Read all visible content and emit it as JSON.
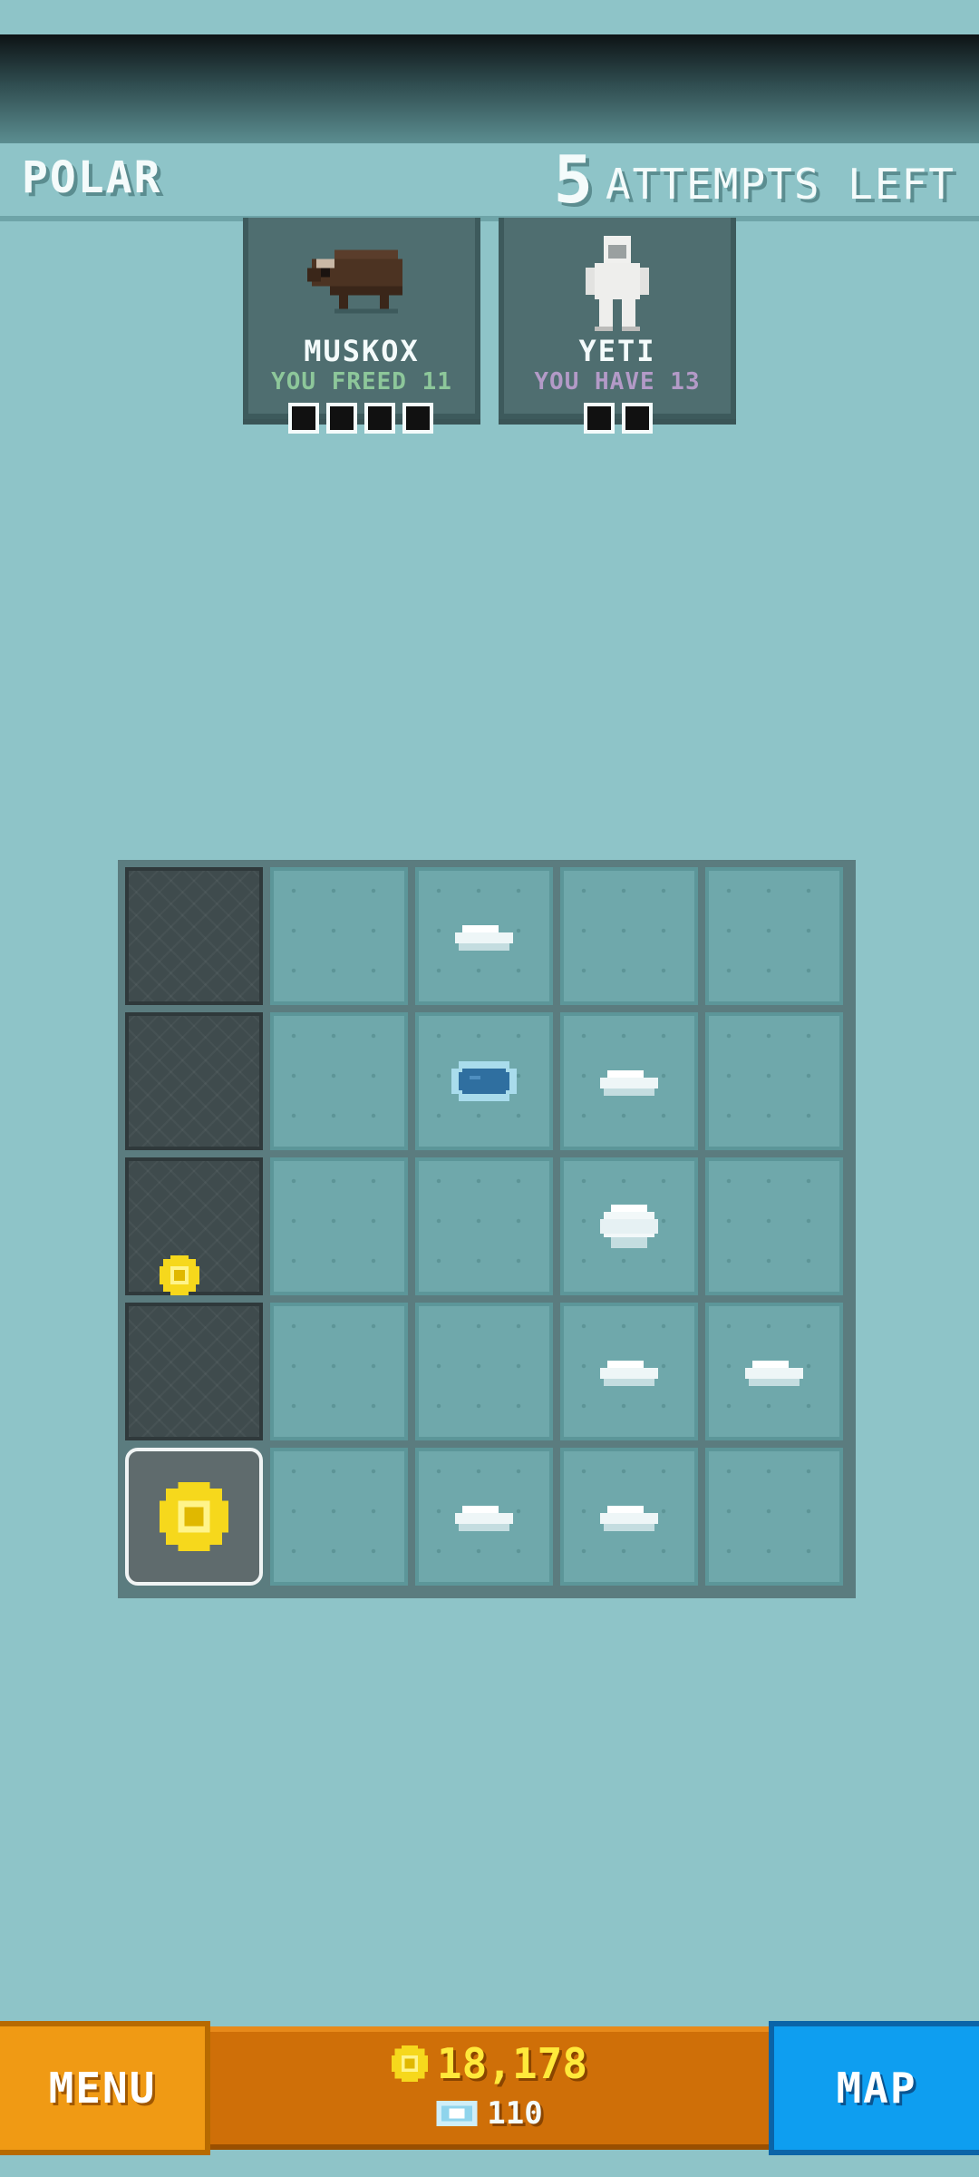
{
  "header": {
    "zone_name": "POLAR",
    "attempts_number": "5",
    "attempts_label": "ATTEMPTS LEFT"
  },
  "animals": [
    {
      "name": "MUSKOX",
      "status": "YOU FREED 11",
      "pips": 4,
      "status_color": "#8dc79a"
    },
    {
      "name": "YETI",
      "status": "YOU HAVE 13",
      "pips": 2,
      "status_color": "#b39ac7"
    }
  ],
  "board": {
    "rows": 5,
    "cols": 5,
    "cells": [
      [
        "rock",
        "ice",
        "snow",
        "ice",
        "ice"
      ],
      [
        "rock",
        "ice",
        "hole",
        "snow",
        "ice"
      ],
      [
        "rock-coin",
        "ice",
        "ice",
        "snowball",
        "ice"
      ],
      [
        "rock",
        "ice",
        "ice",
        "snow",
        "snow"
      ],
      [
        "start-coin",
        "ice",
        "snow",
        "snow",
        "ice"
      ]
    ]
  },
  "footer": {
    "menu_label": "MENU",
    "coins": "18,178",
    "gems": "110",
    "map_label": "MAP"
  },
  "colors": {
    "background": "#8ec4c8",
    "menu_button": "#f09a14",
    "currency_panel": "#cf6f08",
    "map_button": "#0e9ef0",
    "coin_text": "#ffe93a"
  }
}
